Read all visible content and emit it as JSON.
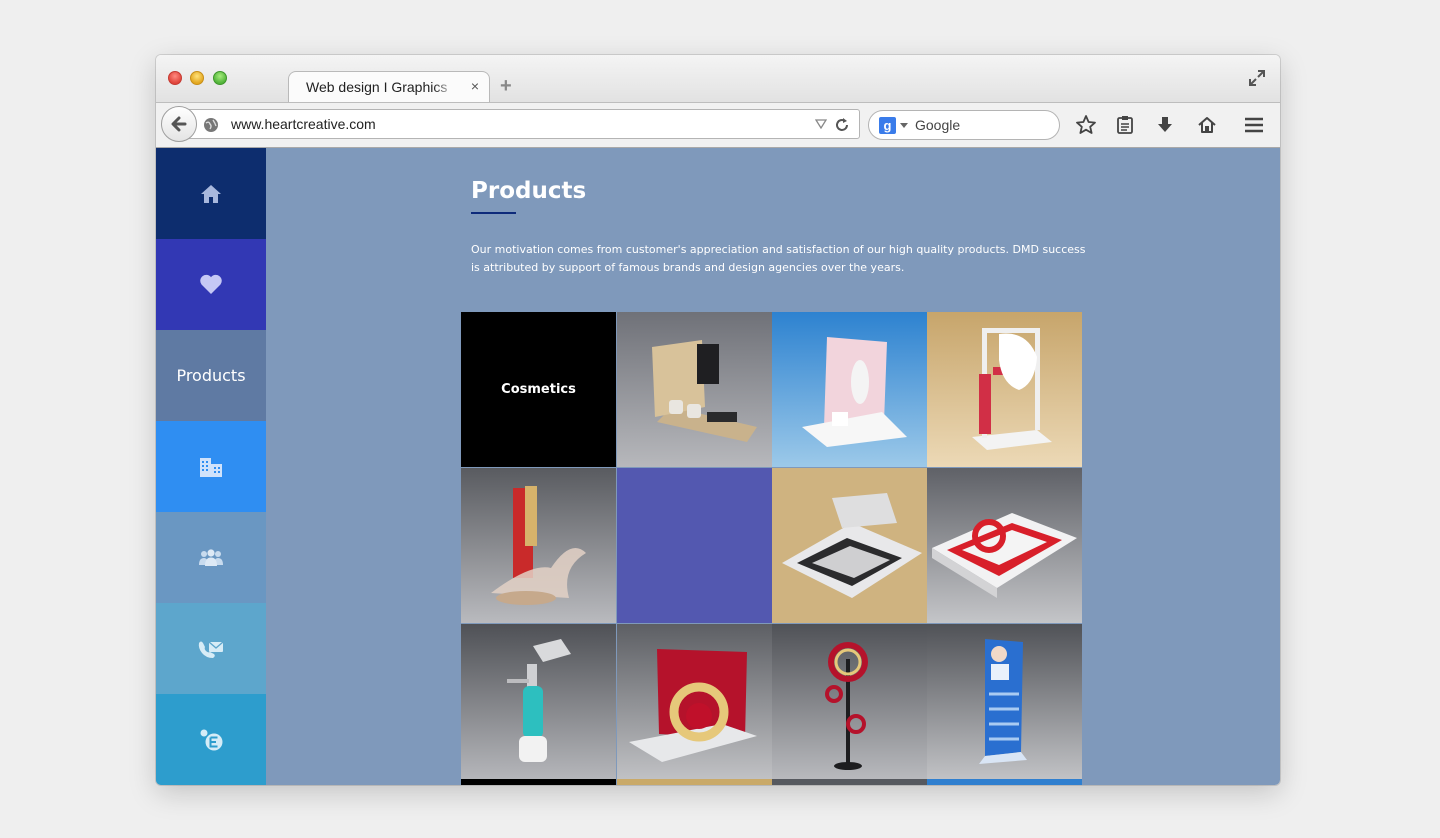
{
  "browser": {
    "tab_title": "Web design I Graphics",
    "tab_close": "×",
    "new_tab": "+",
    "url": "www.heartcreative.com",
    "search_engine_badge": "g",
    "search_placeholder": "Google"
  },
  "sidebar": {
    "items": [
      {
        "name": "home",
        "icon": "home-icon",
        "color": "#0d2d6e"
      },
      {
        "name": "favorites",
        "icon": "heart-icon",
        "color": "#3238b4"
      },
      {
        "name": "products",
        "label": "Products",
        "color": "#5f7aa3",
        "active": true
      },
      {
        "name": "company",
        "icon": "building-icon",
        "color": "#2f8ef2"
      },
      {
        "name": "team",
        "icon": "group-icon",
        "color": "#6a97c2"
      },
      {
        "name": "contact",
        "icon": "contact-icon",
        "color": "#5da6cc"
      },
      {
        "name": "extra",
        "icon": "e-icon",
        "color": "#2d9dcd"
      }
    ]
  },
  "main": {
    "title": "Products",
    "description": "Our motivation comes from customer's appreciation and satisfaction of our high quality products. DMD success is attributed by support of famous brands and design agencies over the years."
  },
  "grid": {
    "category_label": "Cosmetics",
    "tiles": [
      {
        "name": "cosmetics-tile",
        "kind": "label",
        "bg": "#000000"
      },
      {
        "name": "skii-stand-tile",
        "kind": "photo",
        "bg": "#8f9197"
      },
      {
        "name": "pink-stand-tile",
        "kind": "photo",
        "bg": "#3d97d6"
      },
      {
        "name": "mask-stand-tile",
        "kind": "photo",
        "bg": "#d8b682"
      },
      {
        "name": "red-bottle-stand-tile",
        "kind": "photo",
        "bg": "#8c8e92"
      },
      {
        "name": "blank-tile",
        "kind": "blank",
        "bg": "#5358b0"
      },
      {
        "name": "tray-display-tile",
        "kind": "photo",
        "bg": "#cfb380"
      },
      {
        "name": "red-ring-tray-tile",
        "kind": "photo",
        "bg": "#8e9095"
      },
      {
        "name": "dropper-bottle-tile",
        "kind": "photo",
        "bg": "#8d8f94"
      },
      {
        "name": "olay-display-tile",
        "kind": "photo",
        "bg": "#8e9096"
      },
      {
        "name": "ring-floor-stand-tile",
        "kind": "photo",
        "bg": "#8d8f93"
      },
      {
        "name": "blue-tower-tile",
        "kind": "photo",
        "bg": "#8e9095"
      }
    ]
  }
}
